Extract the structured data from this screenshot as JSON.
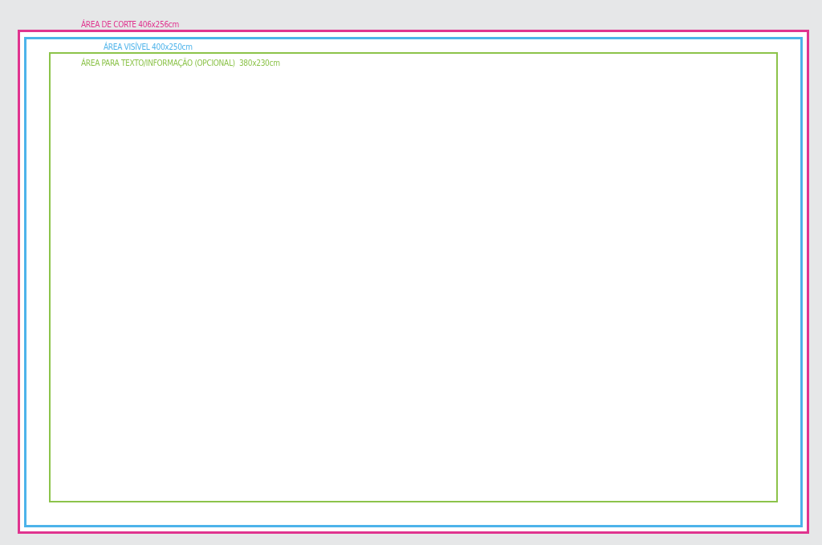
{
  "frames": [
    {
      "label": "ÁREA DE CORTE 406x256cm",
      "color": "#e0348f"
    },
    {
      "label": "ÁREA VISÍVEL 400x250cm",
      "color": "#4db3ea"
    },
    {
      "label": "ÁREA PARA TEXTO/INFORMAÇÃO (OPCIONAL)  380x230cm",
      "color": "#8cc34a"
    }
  ]
}
